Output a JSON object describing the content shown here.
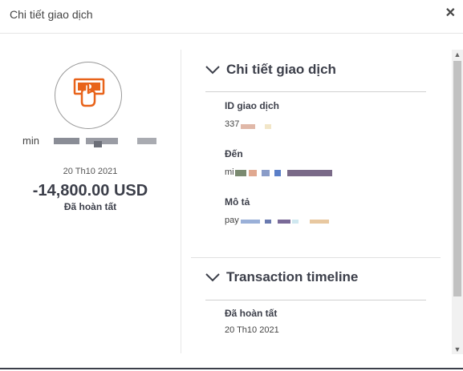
{
  "dialog": {
    "title": "Chi tiết giao dịch",
    "close_icon": "close-icon"
  },
  "summary": {
    "icon": "cash-payment-icon",
    "icon_color": "#e8631a",
    "name_prefix": "min",
    "date": "20 Th10 2021",
    "amount": "-14,800.00 USD",
    "status": "Đã hoàn tất"
  },
  "details": {
    "section_title": "Chi tiết giao dịch",
    "id_label": "ID giao dịch",
    "id_value_prefix": "337",
    "to_label": "Đến",
    "to_value_prefix": "mi",
    "desc_label": "Mô tả",
    "desc_value_prefix": "pay"
  },
  "timeline": {
    "section_title": "Transaction timeline",
    "status": "Đã hoàn tất",
    "date": "20 Th10 2021"
  }
}
